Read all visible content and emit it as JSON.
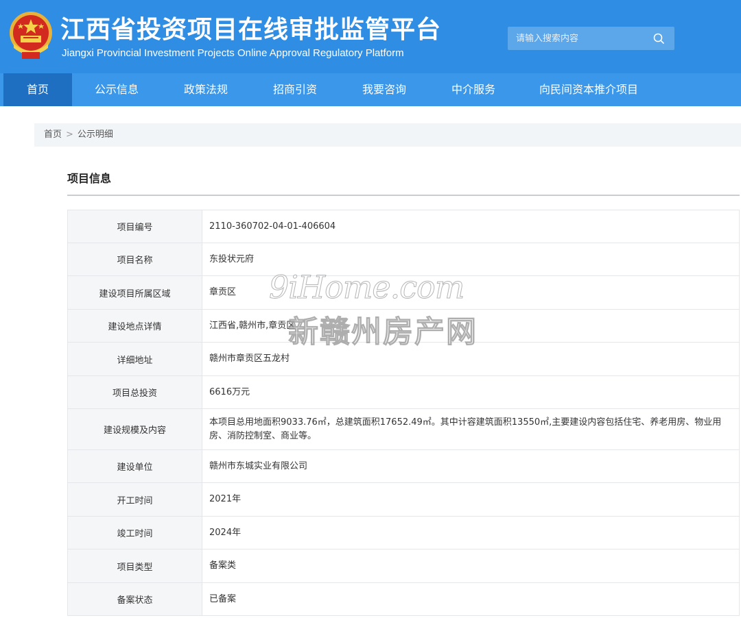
{
  "header": {
    "title_cn": "江西省投资项目在线审批监管平台",
    "title_en": "Jiangxi Provincial Investment Projects Online Approval Regulatory Platform",
    "emblem_icon": "national-emblem-icon",
    "search": {
      "placeholder": "请输入搜索内容",
      "button_icon": "search-icon"
    }
  },
  "nav": {
    "items": [
      {
        "label": "首页",
        "active": true
      },
      {
        "label": "公示信息"
      },
      {
        "label": "政策法规"
      },
      {
        "label": "招商引资"
      },
      {
        "label": "我要咨询"
      },
      {
        "label": "中介服务"
      },
      {
        "label": "向民间资本推介项目"
      }
    ]
  },
  "breadcrumb": {
    "home": "首页",
    "separator": ">",
    "current": "公示明细"
  },
  "section": {
    "title": "项目信息"
  },
  "rows": [
    {
      "label": "项目编号",
      "value": "2110-360702-04-01-406604"
    },
    {
      "label": "项目名称",
      "value": "东投状元府"
    },
    {
      "label": "建设项目所属区域",
      "value": "章贡区"
    },
    {
      "label": "建设地点详情",
      "value": "江西省,赣州市,章贡区"
    },
    {
      "label": "详细地址",
      "value": "赣州市章贡区五龙村"
    },
    {
      "label": "项目总投资",
      "value": "6616万元"
    },
    {
      "label": "建设规模及内容",
      "value": "本项目总用地面积9033.76㎡，总建筑面积17652.49㎡。其中计容建筑面积13550㎡,主要建设内容包括住宅、养老用房、物业用房、消防控制室、商业等。"
    },
    {
      "label": "建设单位",
      "value": "赣州市东城实业有限公司"
    },
    {
      "label": "开工时间",
      "value": "2021年"
    },
    {
      "label": "竣工时间",
      "value": "2024年"
    },
    {
      "label": "项目类型",
      "value": "备案类"
    },
    {
      "label": "备案状态",
      "value": "已备案"
    }
  ],
  "watermark": {
    "en": "9iHome.com",
    "cn": "新赣州房产网"
  },
  "colors": {
    "header_bg": "#2f8de4",
    "nav_bg": "#3a97ea",
    "nav_active_bg": "#1e6fc2",
    "label_bg": "#f5f6f8",
    "border": "#e4e6e9"
  }
}
